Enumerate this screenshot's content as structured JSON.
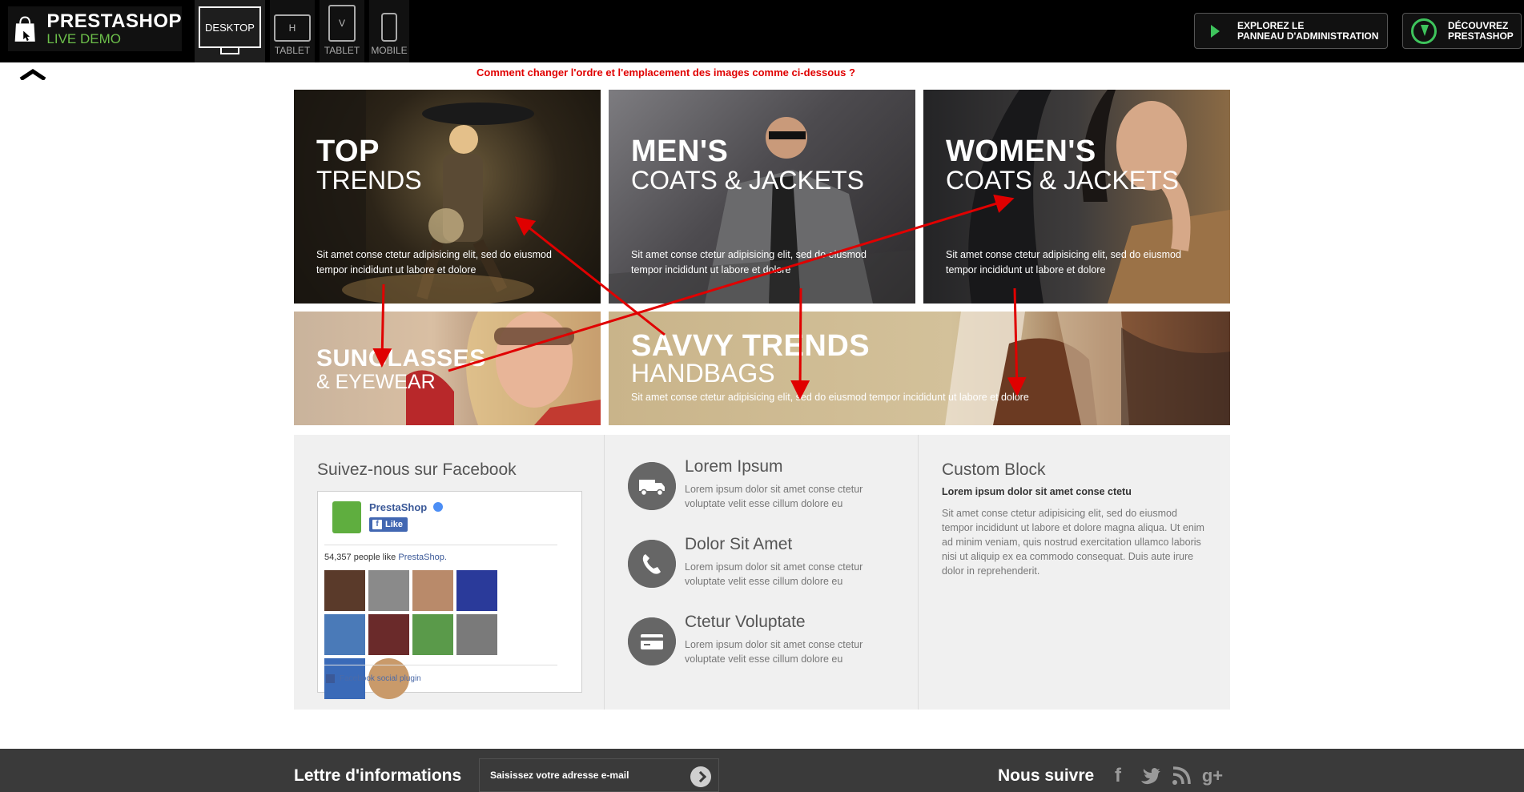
{
  "topbar": {
    "logo_title": "PRESTASHOP",
    "logo_subtitle": "LIVE DEMO",
    "devices": [
      {
        "label": "DESKTOP",
        "icon": "desktop-icon"
      },
      {
        "glyph": "H",
        "label": "TABLET",
        "icon": "tablet-horizontal-icon"
      },
      {
        "glyph": "V",
        "label": "TABLET",
        "icon": "tablet-vertical-icon"
      },
      {
        "label": "MOBILE",
        "icon": "mobile-icon"
      }
    ],
    "admin_button": {
      "line1": "EXPLOREZ LE",
      "line2": "PANNEAU D'ADMINISTRATION"
    },
    "discover_button": {
      "line1": "DÉCOUVREZ",
      "line2": "PRESTASHOP"
    }
  },
  "question": "Comment changer l'ordre et l'emplacement des images comme ci-dessous ?",
  "banners": [
    {
      "title1": "TOP",
      "title2": "TRENDS",
      "desc": "Sit amet conse ctetur adipisicing elit, sed do eiusmod tempor incididunt ut labore et dolore"
    },
    {
      "title1": "MEN'S",
      "title2": "COATS & JACKETS",
      "desc": "Sit amet conse ctetur adipisicing elit, sed do eiusmod tempor incididunt ut labore et dolore"
    },
    {
      "title1": "WOMEN'S",
      "title2": "COATS & JACKETS",
      "desc": "Sit amet conse ctetur adipisicing elit, sed do eiusmod tempor incididunt ut labore et dolore"
    },
    {
      "title1": "SUNGLASSES",
      "title2": "& EYEWEAR"
    },
    {
      "title1": "SAVVY TRENDS",
      "title2": "HANDBAGS",
      "desc": "Sit amet conse ctetur adipisicing elit, sed do eiusmod tempor incididunt ut labore et dolore"
    }
  ],
  "facebook": {
    "title": "Suivez-nous sur Facebook",
    "page_name": "PrestaShop",
    "like_label": "Like",
    "count_text": "54,357 people like",
    "count_link": "PrestaShop.",
    "plugin_label": "Facebook social plugin"
  },
  "info": [
    {
      "title": "Lorem Ipsum",
      "text": "Lorem ipsum dolor sit amet conse ctetur voluptate velit esse cillum dolore eu",
      "icon": "truck-icon"
    },
    {
      "title": "Dolor Sit Amet",
      "text": "Lorem ipsum dolor sit amet conse ctetur voluptate velit esse cillum dolore eu",
      "icon": "phone-icon"
    },
    {
      "title": "Ctetur Voluptate",
      "text": "Lorem ipsum dolor sit amet conse ctetur voluptate velit esse cillum dolore eu",
      "icon": "credit-card-icon"
    }
  ],
  "custom_block": {
    "title": "Custom Block",
    "subtitle": "Lorem ipsum dolor sit amet conse ctetu",
    "text": "Sit amet conse ctetur adipisicing elit, sed do eiusmod tempor incididunt ut labore et dolore magna aliqua. Ut enim ad minim veniam, quis nostrud exercitation ullamco laboris nisi ut aliquip ex ea commodo consequat. Duis aute irure dolor in reprehenderit."
  },
  "footer": {
    "newsletter_label": "Lettre d'informations",
    "newsletter_placeholder": "Saisissez votre adresse e-mail",
    "follow_label": "Nous suivre",
    "socials": [
      "facebook-icon",
      "twitter-icon",
      "rss-icon",
      "google-plus-icon"
    ]
  },
  "colors": {
    "accent_green": "#3ec45c",
    "question_red": "#e00000",
    "arrow_red": "#e00000"
  }
}
